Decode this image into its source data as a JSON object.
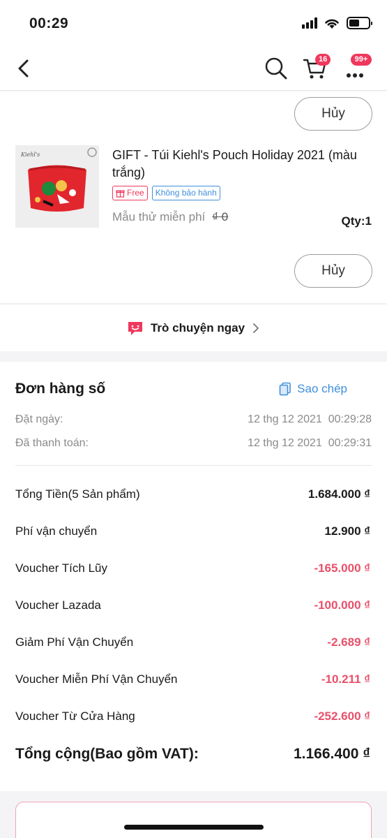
{
  "status_bar": {
    "time": "00:29",
    "battery_level": 0.55
  },
  "nav": {
    "icons": [
      "back-icon",
      "search-icon",
      "cart-icon",
      "more-icon"
    ],
    "cart_badge": "16",
    "more_badge": "99+"
  },
  "product": {
    "cancel_label": "Hủy",
    "title": "GIFT - Túi Kiehl's Pouch Holiday 2021 (màu trắng)",
    "tag_free": "Free",
    "tag_warranty": "Không bảo hành",
    "sample_label": "Mẫu thử miễn phí",
    "sample_price": "₫ 0",
    "qty_label": "Qty:",
    "qty_value": "1",
    "image_brand": "Kiehl's"
  },
  "chat": {
    "label": "Trò chuyện ngay"
  },
  "order": {
    "title": "Đơn hàng số",
    "copy_label": "Sao chép",
    "placed_label": "Đặt ngày:",
    "placed_value": "12 thg 12 2021  00:29:28",
    "paid_label": "Đã thanh toán:",
    "paid_value": "12 thg 12 2021  00:29:31",
    "rows": [
      {
        "label": "Tổng Tiền(5 Sản phẩm)",
        "value": "1.684.000 ₫",
        "negative": false
      },
      {
        "label": "Phí vận chuyển",
        "value": "12.900 ₫",
        "negative": false
      },
      {
        "label": "Voucher Tích Lũy",
        "value": "-165.000 ₫",
        "negative": true
      },
      {
        "label": "Voucher Lazada",
        "value": "-100.000 ₫",
        "negative": true
      },
      {
        "label": "Giảm Phí Vận Chuyển",
        "value": "-2.689 ₫",
        "negative": true
      },
      {
        "label": "Voucher Miễn Phí Vận Chuyển",
        "value": "-10.211 ₫",
        "negative": true
      },
      {
        "label": "Voucher Từ Cửa Hàng",
        "value": "-252.600 ₫",
        "negative": true
      }
    ],
    "total_label": "Tổng cộng(Bao gồm VAT):",
    "total_value": "1.166.400 ₫"
  },
  "colors": {
    "accent_pink": "#f0385c",
    "accent_blue": "#3f8fdc",
    "negative_red": "#e8506a"
  }
}
